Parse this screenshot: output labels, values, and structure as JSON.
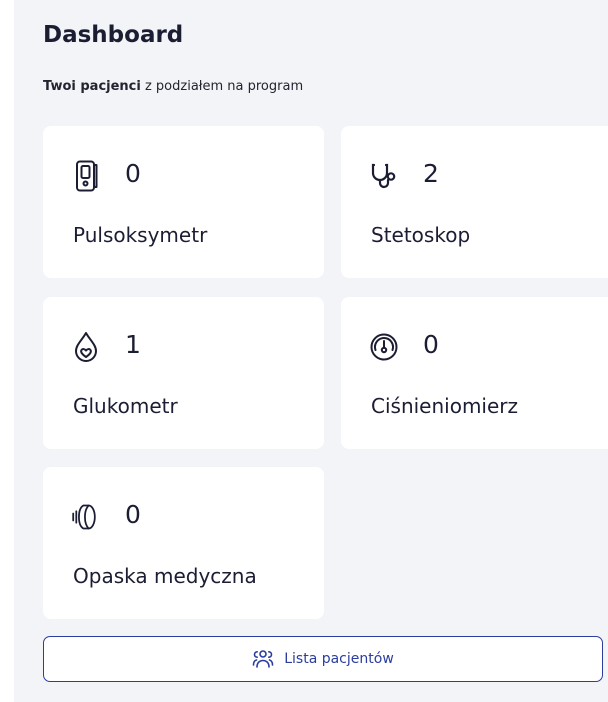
{
  "header": {
    "title": "Dashboard",
    "subtitle_strong": "Twoi pacjenci",
    "subtitle_rest": " z podziałem na program"
  },
  "programs": [
    {
      "label": "Pulsoksymetr",
      "count": "0",
      "icon": "pulse-oximeter-icon"
    },
    {
      "label": "Stetoskop",
      "count": "2",
      "icon": "stethoscope-icon"
    },
    {
      "label": "Glukometr",
      "count": "1",
      "icon": "blood-drop-icon"
    },
    {
      "label": "Ciśnieniomierz",
      "count": "0",
      "icon": "gauge-icon"
    },
    {
      "label": "Opaska medyczna",
      "count": "0",
      "icon": "medical-band-icon"
    }
  ],
  "patients_button": {
    "label": "Lista pacjentów",
    "icon": "users-icon"
  },
  "colors": {
    "accent": "#2b3d9e",
    "background": "#f3f4f7",
    "card": "#ffffff",
    "text": "#1b1d33"
  }
}
